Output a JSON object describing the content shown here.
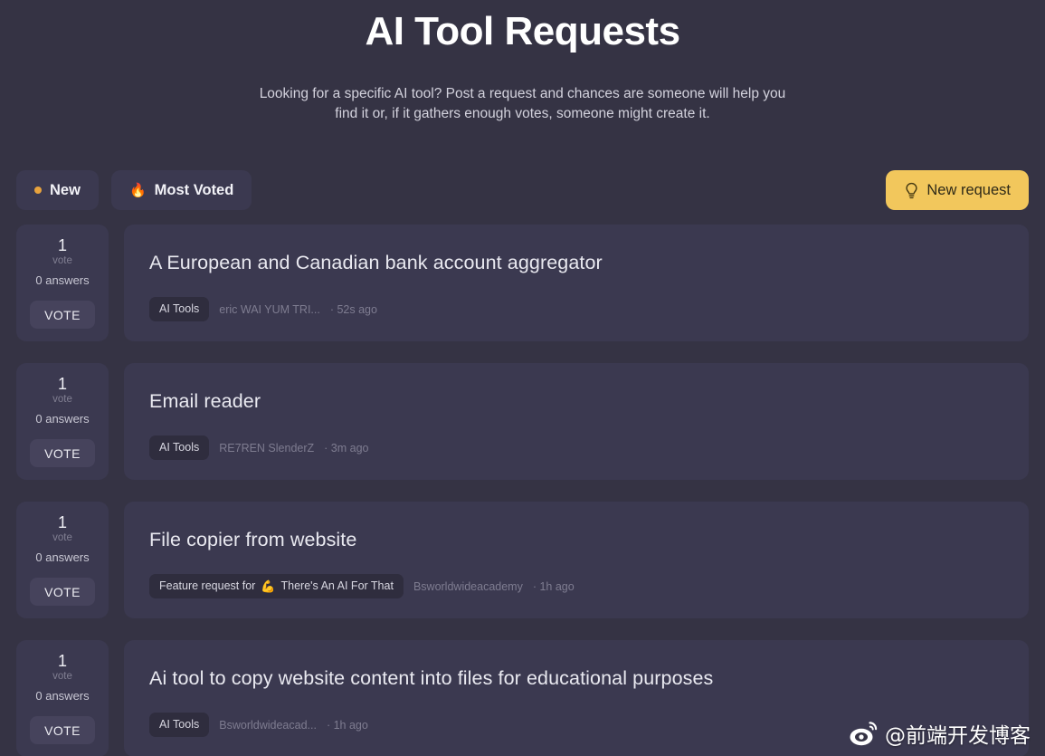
{
  "header": {
    "title": "AI Tool Requests",
    "subtitle_line1": "Looking for a specific AI tool? Post a request and chances are someone will help you",
    "subtitle_line2": "find it or, if it gathers enough votes, someone might create it."
  },
  "toolbar": {
    "tabs": [
      {
        "label": "New",
        "icon": "orange-dot",
        "active": true
      },
      {
        "label": "Most Voted",
        "icon": "fire-emoji",
        "emoji": "🔥",
        "active": false
      }
    ],
    "new_request_label": "New request",
    "new_request_icon": "lightbulb-icon"
  },
  "colors": {
    "page_background": "#353344",
    "card_background": "#3b3950",
    "chip_background": "#2f2d3e",
    "accent_amber": "#f2c75c",
    "dot_orange": "#e8a33d",
    "vote_button": "#46435c"
  },
  "labels": {
    "vote_word": "vote",
    "vote_button": "VOTE"
  },
  "requests": [
    {
      "votes": "1",
      "vote_word": "vote",
      "answers": "0 answers",
      "vote_button": "VOTE",
      "title": "A European and Canadian bank account aggregator",
      "tag": "AI Tools",
      "tag_emoji": "",
      "author": "eric WAI YUM TRI...",
      "time": "· 52s ago"
    },
    {
      "votes": "1",
      "vote_word": "vote",
      "answers": "0 answers",
      "vote_button": "VOTE",
      "title": "Email reader",
      "tag": "AI Tools",
      "tag_emoji": "",
      "author": "RE7REN SlenderZ",
      "time": "· 3m ago"
    },
    {
      "votes": "1",
      "vote_word": "vote",
      "answers": "0 answers",
      "vote_button": "VOTE",
      "title": "File copier from website",
      "tag_prefix": "Feature request for",
      "tag": "There's An AI For That",
      "tag_emoji": "💪",
      "author": "Bsworldwideacademy",
      "time": "· 1h ago"
    },
    {
      "votes": "1",
      "vote_word": "vote",
      "answers": "0 answers",
      "vote_button": "VOTE",
      "title": "Ai tool to copy website content into files for educational purposes",
      "tag": "AI Tools",
      "tag_emoji": "",
      "author": "Bsworldwideacad...",
      "time": "· 1h ago"
    }
  ],
  "watermark": {
    "text": "@前端开发博客",
    "icon": "weibo-icon"
  }
}
